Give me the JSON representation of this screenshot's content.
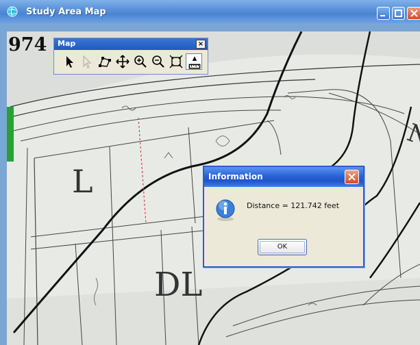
{
  "window": {
    "title": "Study Area Map",
    "icon": "globe-app-icon",
    "buttons": [
      "minimize-icon",
      "maximize-icon",
      "close-icon"
    ]
  },
  "map": {
    "corner_number": "974",
    "labels": {
      "lot_left": "L",
      "lot_center": "DL"
    }
  },
  "toolbar": {
    "title": "Map",
    "close_label": "×",
    "tools": [
      "select-arrow-icon",
      "disabled-select-icon",
      "identify-vertices-icon",
      "pan-icon",
      "zoom-in-icon",
      "zoom-out-icon",
      "full-extent-icon",
      "measure-icon"
    ]
  },
  "dialog": {
    "title": "Information",
    "message": "Distance = 121.742 feet",
    "ok_label": "OK",
    "icon": "info-icon"
  },
  "colors": {
    "titlebar": "#4a84d2",
    "dialog_border": "#2a5fc7",
    "dialog_bg": "#ece9d8",
    "close_red": "#d64a2a",
    "measure_line": "#e03b3b"
  }
}
